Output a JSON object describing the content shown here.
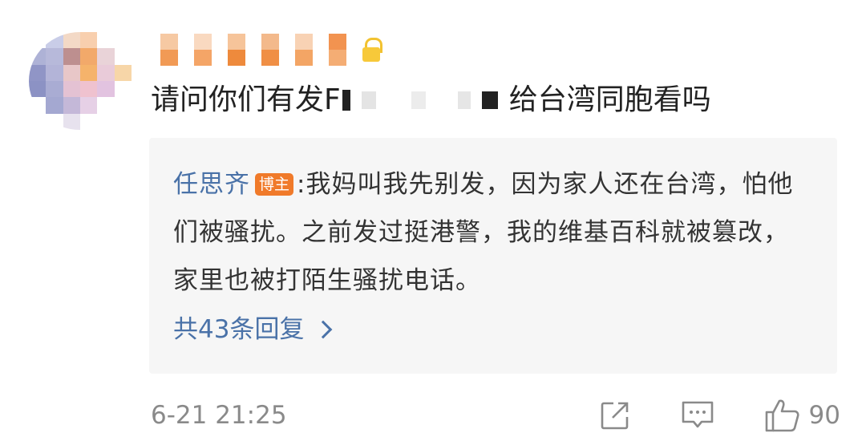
{
  "comment": {
    "question_before": "请问你们有发F",
    "question_after": "给台湾同胞看吗"
  },
  "reply": {
    "author": "任思齐",
    "badge": "博主",
    "separator": ":",
    "text": "我妈叫我先别发，因为家人还在台湾，怕他们被骚扰。之前发过挺港警，我的维基百科就被篡改，家里也被打陌生骚扰电话。",
    "more_replies": "共43条回复"
  },
  "footer": {
    "timestamp": "6-21 21:25",
    "like_count": "90"
  },
  "icons": {
    "share": "share-icon",
    "comment": "comment-icon",
    "like": "thumbs-up-icon",
    "more_replies": "chevron-right-icon"
  },
  "colors": {
    "link_blue": "#4a72a8",
    "badge_orange": "#f07a2a",
    "reply_bg": "#f6f6f6",
    "meta_gray": "#8a8a8a"
  }
}
